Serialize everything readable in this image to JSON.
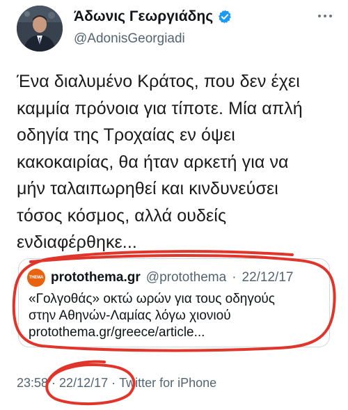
{
  "tweet": {
    "author": {
      "display_name": "Άδωνις Γεωργιάδης",
      "handle": "@AdonisGeorgiadi",
      "verified": true,
      "avatar_icon": "profile-photo"
    },
    "more_icon": "more-dots-icon",
    "text_lines": [
      "Ένα διαλυμένο Κράτος, που δεν έχει",
      "καμμία πρόνοια για τίποτε. Μία απλή",
      "οδηγία της Τροχαίας εν όψει",
      "κακοκαιρίας, θα ήταν αρκετή για να",
      "μήν ταλαιπωρηθεί και κινδυνεύσει",
      "τόσος κόσμος, αλλά ουδείς",
      "ενδιαφέρθηκε..."
    ],
    "quote": {
      "logo_text": "THEMA",
      "source_name": "protothema.gr",
      "source_handle": "@protothema",
      "separator": "·",
      "date": "22/12/17",
      "body_lines": [
        "«Γολγοθάς» οκτώ ωρών για τους οδηγούς",
        "στην Αθηνών-Λαμίας λόγω χιονιού"
      ],
      "link": "protothema.gr/greece/article..."
    },
    "meta": {
      "time": "23:58",
      "separator": "·",
      "date": "22/12/17",
      "client": "Twitter for iPhone"
    },
    "annotation_color": "#e0352b",
    "accent_color": "#1d9bf0"
  }
}
